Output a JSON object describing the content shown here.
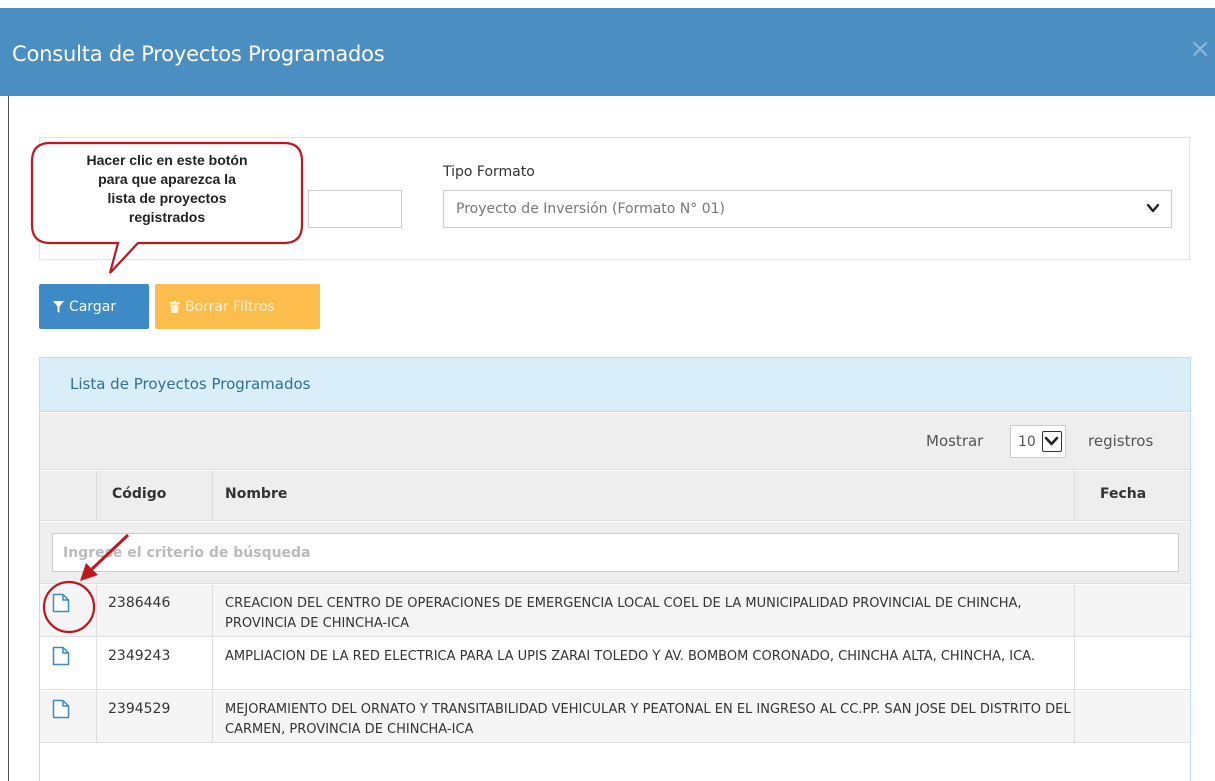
{
  "modal": {
    "title": "Consulta de Proyectos Programados",
    "close_symbol": "×"
  },
  "filters": {
    "tipo_formato_label": "Tipo Formato",
    "tipo_formato_value": "Proyecto de Inversión (Formato N° 01)"
  },
  "callout": {
    "lines": [
      "Hacer clic en este botón",
      "para que aparezca la",
      "lista de proyectos",
      "registrados"
    ]
  },
  "buttons": {
    "cargar_label": "Cargar",
    "borrar_label": "Borrar Filtros"
  },
  "list": {
    "title": "Lista de Proyectos Programados",
    "mostrar_label": "Mostrar",
    "page_length": "10",
    "registros_label": "registros",
    "columns": {
      "code": "Código",
      "name": "Nombre",
      "date": "Fecha"
    },
    "search_placeholder": "Ingrese el criterio de búsqueda",
    "rows": [
      {
        "code": "2386446",
        "name": "CREACION DEL CENTRO DE OPERACIONES DE EMERGENCIA LOCAL COEL DE LA MUNICIPALIDAD PROVINCIAL DE CHINCHA, PROVINCIA DE CHINCHA-ICA",
        "date": ""
      },
      {
        "code": "2349243",
        "name": "AMPLIACION DE LA RED ELECTRICA PARA LA UPIS ZARAI TOLEDO Y AV. BOMBOM CORONADO, CHINCHA ALTA, CHINCHA, ICA.",
        "date": ""
      },
      {
        "code": "2394529",
        "name": "MEJORAMIENTO DEL ORNATO Y TRANSITABILIDAD VEHICULAR Y PEATONAL EN EL INGRESO AL CC.PP. SAN JOSE DEL DISTRITO DEL CARMEN, PROVINCIA DE CHINCHA-ICA",
        "date": ""
      }
    ]
  },
  "colors": {
    "header": "#4a8ec2",
    "primary_button": "#3d8ac7",
    "warning_button": "#fcbd4d",
    "panel_heading": "#d9eef8",
    "annotation_red": "#c0161d"
  },
  "icons": {
    "close": "close-icon",
    "filter": "filter-icon",
    "trash": "trash-icon",
    "row_action": "document-icon",
    "dropdown": "chevron-down-icon"
  }
}
